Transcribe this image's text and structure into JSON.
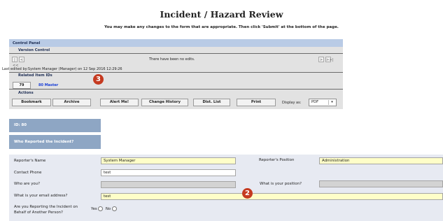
{
  "page": {
    "title": "Incident / Hazard Review",
    "subtitle": "You may make any changes to the form that are appropriate. Then click 'Submit' at the bottom of the page."
  },
  "control_panel": {
    "header": "Control Panel",
    "version_control_label": "Version Control",
    "nav_first": "|<<",
    "nav_prev": "<",
    "nav_next": ">",
    "nav_last": ">>|",
    "edits_status": "There have been no edits.",
    "last_edited": "Last edited by:System Manager (Manager) on 12 Sep 2016 12:29:26",
    "related_label": "Related Item IDs",
    "related_id": "79",
    "related_master": "80 Master",
    "actions_label": "Actions",
    "buttons": {
      "bookmark": "Bookmark",
      "archive": "Archive",
      "alert": "Alert Me!",
      "change_history": "Change History",
      "dist_list": "Dist. List",
      "print": "Print"
    },
    "display_as_label": "Display as:",
    "display_as_value": "PDF"
  },
  "badges": {
    "b3": "3",
    "b2": "2"
  },
  "id_tab": "ID: 80",
  "section_tab": "Who Reported the Incident?",
  "form": {
    "reporter_name_label": "Reporter's Name",
    "reporter_name_value": "System Manager",
    "reporter_position_label": "Reporter's Position",
    "reporter_position_value": "Administration",
    "contact_phone_label": "Contact Phone",
    "contact_phone_value": "test",
    "who_are_you_label": "Who are you?",
    "what_position_label": "What is your position?",
    "email_label": "What is your email address?",
    "email_value": "test",
    "behalf_label_line1": "Are you Reporting the Incident on",
    "behalf_label_line2": "Behalf of Another Person?",
    "yes": "Yes",
    "no": "No"
  },
  "colors": {
    "panel_header": "#b9cbe6",
    "tab": "#8ea6c4",
    "form_bg": "#e7eaf2",
    "field_yellow": "#fefec8",
    "badge": "#c53a20",
    "link_blue": "#1a3fd6"
  }
}
